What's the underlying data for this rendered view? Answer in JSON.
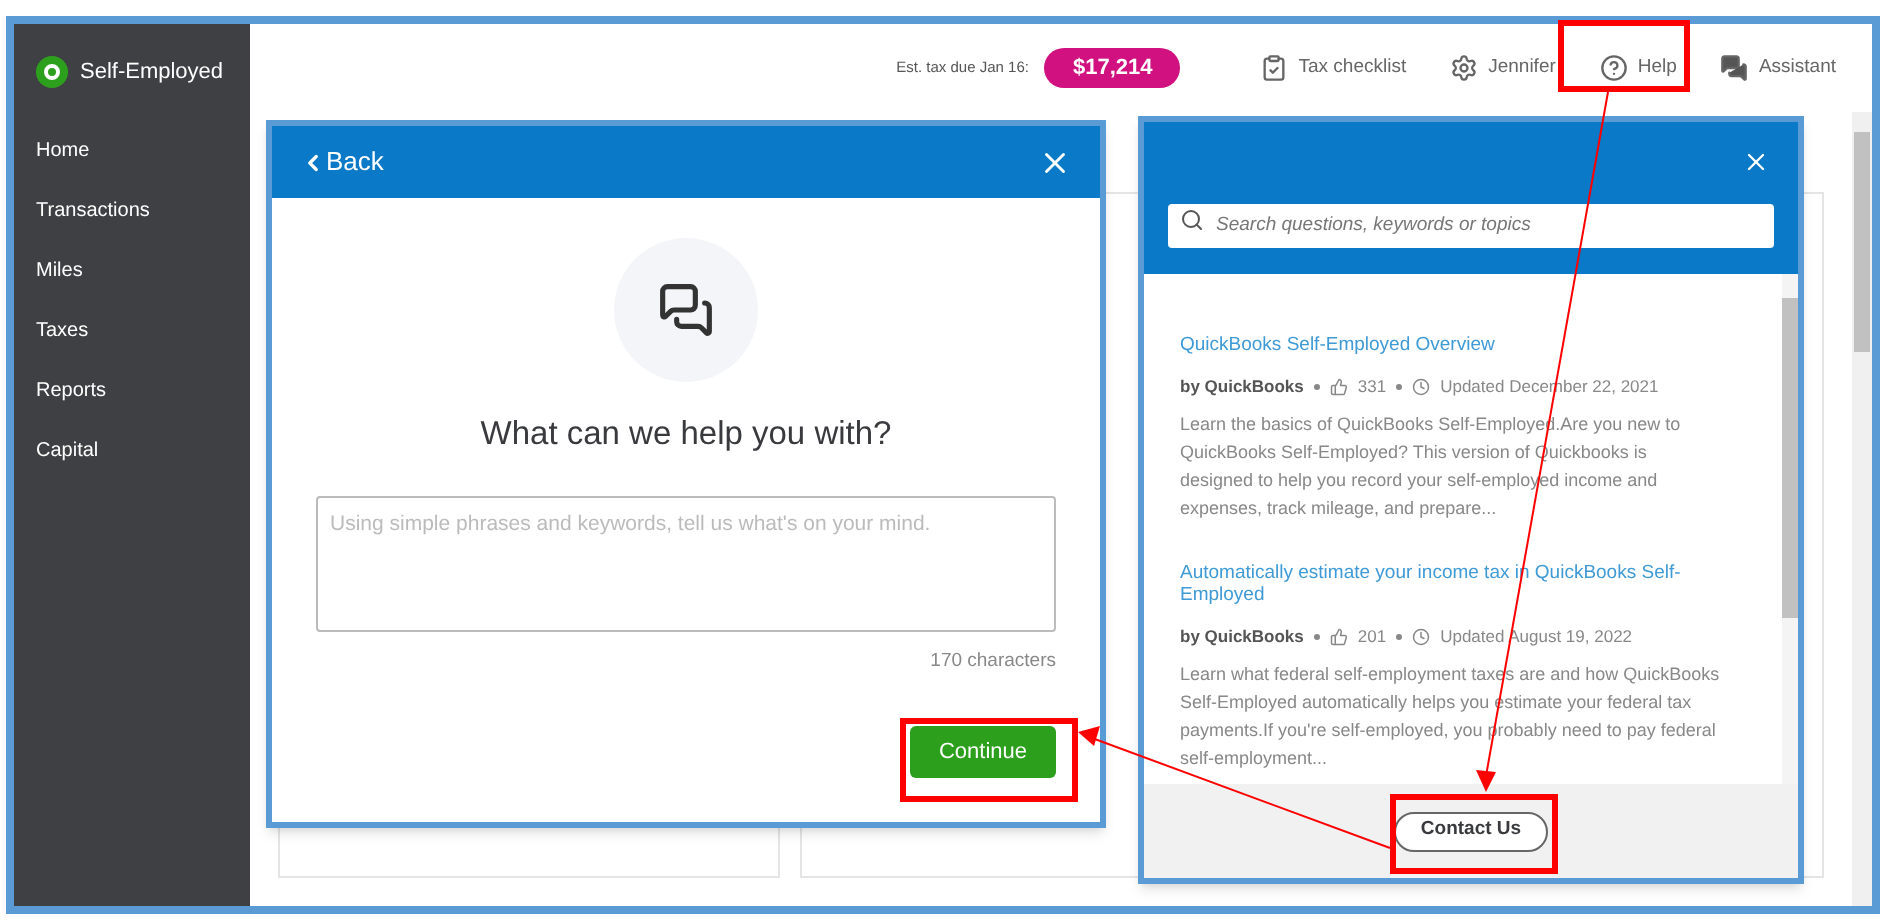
{
  "sidebar": {
    "brand": "Self-Employed",
    "items": [
      {
        "label": "Home"
      },
      {
        "label": "Transactions"
      },
      {
        "label": "Miles"
      },
      {
        "label": "Taxes"
      },
      {
        "label": "Reports"
      },
      {
        "label": "Capital"
      }
    ]
  },
  "header": {
    "tax_label": "Est. tax due Jan 16:",
    "tax_amount": "$17,214",
    "items": [
      {
        "label": "Tax checklist",
        "kind": "checklist"
      },
      {
        "label": "Jennifer",
        "kind": "settings"
      },
      {
        "label": "Help",
        "kind": "help"
      },
      {
        "label": "Assistant",
        "kind": "assistant"
      }
    ]
  },
  "contact_dialog": {
    "back": "Back",
    "title": "What can we help you with?",
    "placeholder": "Using simple phrases and keywords, tell us what's on your mind.",
    "counter": "170 characters",
    "continue": "Continue"
  },
  "help_panel": {
    "search_placeholder": "Search questions, keywords or topics",
    "articles": [
      {
        "title": "QuickBooks Self-Employed Overview",
        "author": "by QuickBooks",
        "likes": "331",
        "updated": "Updated December 22, 2021",
        "summary": "Learn the basics of QuickBooks Self-Employed.Are you new to QuickBooks Self-Employed? This version of Quickbooks is designed to help you record your self-employed income and expenses, track mileage, and prepare..."
      },
      {
        "title": "Automatically estimate your income tax in QuickBooks Self-Employed",
        "author": "by QuickBooks",
        "likes": "201",
        "updated": "Updated August 19, 2022",
        "summary": "Learn what federal self-employment taxes are and how QuickBooks Self-Employed automatically helps you estimate your federal tax payments.If you're self-employed, you probably need to pay federal self-employment..."
      }
    ],
    "contact": "Contact Us"
  }
}
